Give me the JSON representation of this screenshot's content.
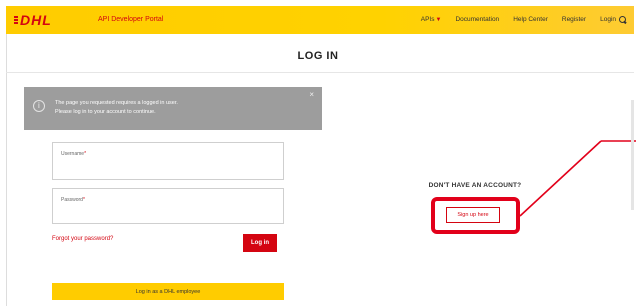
{
  "header": {
    "logo_text": "DHL",
    "portal_title": "API Developer Portal",
    "nav": [
      "APIs",
      "Documentation",
      "Help Center",
      "Register",
      "Login"
    ],
    "search_icon": "search-icon",
    "brand_color": "#ffcc00",
    "accent_color": "#d40511"
  },
  "page": {
    "title": "LOG IN"
  },
  "alert": {
    "icon": "info-icon",
    "line1": "The page you requested requires a logged in user.",
    "line2": "Please log in to your account to continue.",
    "close": "×"
  },
  "form": {
    "username_label": "Username",
    "password_label": "Password",
    "required_mark": "*",
    "username_value": "",
    "password_value": "",
    "forgot_label": "Forgot your password?",
    "login_label": "Log in",
    "employee_label": "Log in as a DHL employee"
  },
  "signup": {
    "heading": "DON'T HAVE AN ACCOUNT?",
    "button_label": "Sign up here"
  },
  "annotation": {
    "highlight_color": "#e2001a"
  }
}
